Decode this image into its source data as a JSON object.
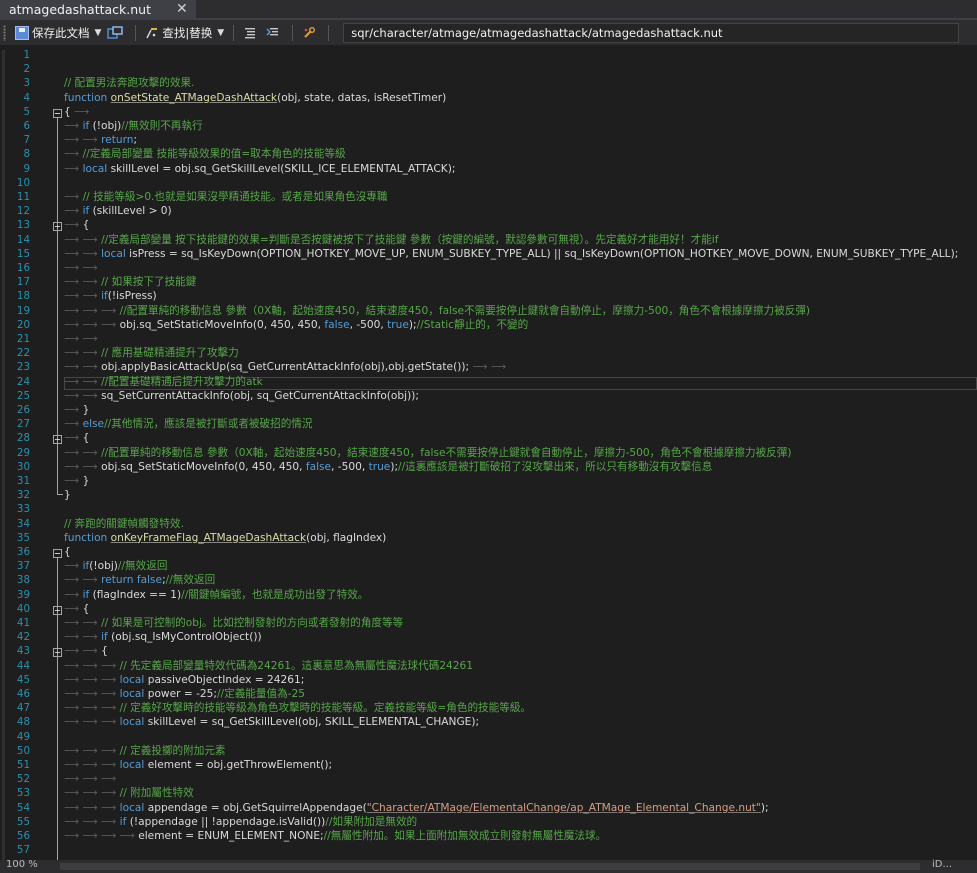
{
  "tab": {
    "title": "atmagedashattack.nut",
    "close_glyph": "✕"
  },
  "toolbar": {
    "save_label": "保存此文档",
    "find_replace_label": "查找|替换",
    "file_path": "sqr/character/atmage/atmagedashattack/atmagedashattack.nut"
  },
  "status": {
    "zoom": "100 %",
    "right_fragment": "iD..."
  },
  "colors": {
    "keyword": "#569cd6",
    "comment": "#57a64a",
    "string": "#d69d85",
    "line_number": "#2b91af",
    "text": "#dcdcdc"
  },
  "lines": [
    {
      "n": "1",
      "parts": []
    },
    {
      "n": "2",
      "parts": []
    },
    {
      "n": "3",
      "parts": [
        [
          "c",
          "// 配置男法奔跑攻擊的效果."
        ]
      ]
    },
    {
      "n": "4",
      "parts": [
        [
          "k",
          "function "
        ],
        [
          "f",
          "onSetState_ATMageDashAttack"
        ],
        [
          "",
          "(obj, state, datas, isResetTimer)"
        ]
      ]
    },
    {
      "n": "5",
      "parts": [
        [
          "",
          "{ "
        ],
        [
          "a",
          "⟶"
        ]
      ]
    },
    {
      "n": "6",
      "parts": [
        [
          "a",
          "⟶ "
        ],
        [
          "k",
          "if"
        ],
        [
          "",
          " (!obj)"
        ],
        [
          "c",
          "//無效則不再執行"
        ]
      ]
    },
    {
      "n": "7",
      "parts": [
        [
          "a",
          "⟶ ⟶ "
        ],
        [
          "k",
          "return"
        ],
        [
          "",
          ";"
        ]
      ]
    },
    {
      "n": "8",
      "parts": [
        [
          "a",
          "⟶ "
        ],
        [
          "c",
          "//定義局部變量 技能等級效果的值=取本角色的技能等級"
        ]
      ]
    },
    {
      "n": "9",
      "parts": [
        [
          "a",
          "⟶ "
        ],
        [
          "k",
          "local"
        ],
        [
          "",
          " skillLevel = obj.sq_GetSkillLevel(SKILL_ICE_ELEMENTAL_ATTACK);"
        ]
      ]
    },
    {
      "n": "10",
      "parts": []
    },
    {
      "n": "11",
      "parts": [
        [
          "a",
          "⟶ "
        ],
        [
          "c",
          "// 技能等級>0.也就是如果沒學精通技能。或者是如果角色沒專職"
        ]
      ]
    },
    {
      "n": "12",
      "parts": [
        [
          "a",
          "⟶ "
        ],
        [
          "k",
          "if"
        ],
        [
          "",
          " (skillLevel > 0)"
        ]
      ]
    },
    {
      "n": "13",
      "parts": [
        [
          "a",
          "⟶ "
        ],
        [
          "",
          "{"
        ]
      ]
    },
    {
      "n": "14",
      "parts": [
        [
          "a",
          "⟶ ⟶ "
        ],
        [
          "c",
          "//定義局部變量 按下技能鍵的效果=判斷是否按鍵被按下了技能鍵 參數（按鍵的編號，默認參數可無視）。先定義好才能用好！才能if"
        ]
      ]
    },
    {
      "n": "15",
      "parts": [
        [
          "a",
          "⟶ ⟶ "
        ],
        [
          "k",
          "local"
        ],
        [
          "",
          " isPress = sq_IsKeyDown(OPTION_HOTKEY_MOVE_UP, ENUM_SUBKEY_TYPE_ALL) || sq_IsKeyDown(OPTION_HOTKEY_MOVE_DOWN, ENUM_SUBKEY_TYPE_ALL);"
        ]
      ]
    },
    {
      "n": "16",
      "parts": [
        [
          "a",
          "⟶ ⟶"
        ]
      ]
    },
    {
      "n": "17",
      "parts": [
        [
          "a",
          "⟶ ⟶ "
        ],
        [
          "c",
          "// 如果按下了技能鍵"
        ]
      ]
    },
    {
      "n": "18",
      "parts": [
        [
          "a",
          "⟶ ⟶ "
        ],
        [
          "k",
          "if"
        ],
        [
          "",
          "(!isPress)"
        ]
      ]
    },
    {
      "n": "19",
      "parts": [
        [
          "a",
          "⟶ ⟶ ⟶ "
        ],
        [
          "c",
          "//配置單純的移動信息 參數（0X軸，起始速度450，結束速度450，false不需要按停止鍵就會自動停止，摩擦力-500，角色不會根據摩擦力被反彈)"
        ]
      ]
    },
    {
      "n": "20",
      "parts": [
        [
          "a",
          "⟶ ⟶ ⟶ "
        ],
        [
          "",
          "obj.sq_SetStaticMoveInfo(0, 450, 450, "
        ],
        [
          "k",
          "false"
        ],
        [
          "",
          ", -500, "
        ],
        [
          "k",
          "true"
        ],
        [
          "",
          ");"
        ],
        [
          "c",
          "//Static靜止的，不變的"
        ]
      ]
    },
    {
      "n": "21",
      "parts": [
        [
          "a",
          "⟶ ⟶"
        ]
      ]
    },
    {
      "n": "22",
      "parts": [
        [
          "a",
          "⟶ ⟶ "
        ],
        [
          "c",
          "// 應用基礎精通提升了攻擊力"
        ]
      ]
    },
    {
      "n": "23",
      "parts": [
        [
          "a",
          "⟶ ⟶ "
        ],
        [
          "",
          "obj.applyBasicAttackUp(sq_GetCurrentAttackInfo(obj),obj.getState()); "
        ],
        [
          "a",
          "⟶ ⟶"
        ]
      ]
    },
    {
      "n": "24",
      "parts": [
        [
          "a",
          "⟶ ⟶ "
        ],
        [
          "c",
          "//配置基礎精通后提升攻擊力的atk"
        ]
      ]
    },
    {
      "n": "25",
      "parts": [
        [
          "a",
          "⟶ ⟶ "
        ],
        [
          "",
          "sq_SetCurrentAttackInfo(obj, sq_GetCurrentAttackInfo(obj));"
        ]
      ]
    },
    {
      "n": "26",
      "parts": [
        [
          "a",
          "⟶ "
        ],
        [
          "",
          "}"
        ]
      ]
    },
    {
      "n": "27",
      "parts": [
        [
          "a",
          "⟶ "
        ],
        [
          "k",
          "else"
        ],
        [
          "c",
          "//其他情況，應該是被打斷或者被破招的情況"
        ]
      ]
    },
    {
      "n": "28",
      "parts": [
        [
          "a",
          "⟶ "
        ],
        [
          "",
          "{"
        ]
      ]
    },
    {
      "n": "29",
      "parts": [
        [
          "a",
          "⟶ ⟶ "
        ],
        [
          "c",
          "//配置單純的移動信息 參數（0X軸，起始速度450，結束速度450，false不需要按停止鍵就會自動停止，摩擦力-500，角色不會根據摩擦力被反彈)"
        ]
      ]
    },
    {
      "n": "30",
      "parts": [
        [
          "a",
          "⟶ ⟶ "
        ],
        [
          "",
          "obj.sq_SetStaticMoveInfo(0, 450, 450, "
        ],
        [
          "k",
          "false"
        ],
        [
          "",
          ", -500, "
        ],
        [
          "k",
          "true"
        ],
        [
          "",
          ");"
        ],
        [
          "c",
          "//這裏應該是被打斷破招了沒攻擊出來，所以只有移動沒有攻擊信息"
        ]
      ]
    },
    {
      "n": "31",
      "parts": [
        [
          "a",
          "⟶ "
        ],
        [
          "",
          "}"
        ]
      ]
    },
    {
      "n": "32",
      "parts": [
        [
          "",
          "}"
        ]
      ]
    },
    {
      "n": "33",
      "parts": []
    },
    {
      "n": "34",
      "parts": [
        [
          "c",
          "// 奔跑的關鍵幀觸發特效."
        ]
      ]
    },
    {
      "n": "35",
      "parts": [
        [
          "k",
          "function "
        ],
        [
          "f",
          "onKeyFrameFlag_ATMageDashAttack"
        ],
        [
          "",
          "(obj, flagIndex)"
        ]
      ]
    },
    {
      "n": "36",
      "parts": [
        [
          "",
          "{"
        ]
      ]
    },
    {
      "n": "37",
      "parts": [
        [
          "a",
          "⟶ "
        ],
        [
          "k",
          "if"
        ],
        [
          "",
          "(!obj)"
        ],
        [
          "c",
          "//無效返回"
        ]
      ]
    },
    {
      "n": "38",
      "parts": [
        [
          "a",
          "⟶ ⟶ "
        ],
        [
          "k",
          "return false"
        ],
        [
          "",
          ";"
        ],
        [
          "c",
          "//無效返回"
        ]
      ]
    },
    {
      "n": "39",
      "parts": [
        [
          "a",
          "⟶ "
        ],
        [
          "k",
          "if"
        ],
        [
          "",
          " (flagIndex == 1)"
        ],
        [
          "c",
          "//關鍵幀編號，也就是成功出發了特效。"
        ]
      ]
    },
    {
      "n": "40",
      "parts": [
        [
          "a",
          "⟶ "
        ],
        [
          "",
          "{"
        ]
      ]
    },
    {
      "n": "41",
      "parts": [
        [
          "a",
          "⟶ ⟶ "
        ],
        [
          "c",
          "// 如果是可控制的obj。比如控制發射的方向或者發射的角度等等"
        ]
      ]
    },
    {
      "n": "42",
      "parts": [
        [
          "a",
          "⟶ ⟶ "
        ],
        [
          "k",
          "if"
        ],
        [
          "",
          " (obj.sq_IsMyControlObject())"
        ]
      ]
    },
    {
      "n": "43",
      "parts": [
        [
          "a",
          "⟶ ⟶ "
        ],
        [
          "",
          "{"
        ]
      ]
    },
    {
      "n": "44",
      "parts": [
        [
          "a",
          "⟶ ⟶ ⟶ "
        ],
        [
          "c",
          "// 先定義局部變量特效代碼為24261。這裏意思為無屬性魔法球代碼24261"
        ]
      ]
    },
    {
      "n": "45",
      "parts": [
        [
          "a",
          "⟶ ⟶ ⟶ "
        ],
        [
          "k",
          "local"
        ],
        [
          "",
          " passiveObjectIndex = 24261;"
        ]
      ]
    },
    {
      "n": "46",
      "parts": [
        [
          "a",
          "⟶ ⟶ ⟶ "
        ],
        [
          "k",
          "local"
        ],
        [
          "",
          " power = -25;"
        ],
        [
          "c",
          "//定義能量值為-25"
        ]
      ]
    },
    {
      "n": "47",
      "parts": [
        [
          "a",
          "⟶ ⟶ ⟶ "
        ],
        [
          "c",
          "// 定義好攻擊時的技能等級為角色攻擊時的技能等級。定義技能等級=角色的技能等級。"
        ]
      ]
    },
    {
      "n": "48",
      "parts": [
        [
          "a",
          "⟶ ⟶ ⟶ "
        ],
        [
          "k",
          "local"
        ],
        [
          "",
          " skillLevel = sq_GetSkillLevel(obj, SKILL_ELEMENTAL_CHANGE);"
        ]
      ]
    },
    {
      "n": "49",
      "parts": []
    },
    {
      "n": "50",
      "parts": [
        [
          "a",
          "⟶ ⟶ ⟶ "
        ],
        [
          "c",
          "// 定義投擲的附加元素"
        ]
      ]
    },
    {
      "n": "51",
      "parts": [
        [
          "a",
          "⟶ ⟶ ⟶ "
        ],
        [
          "k",
          "local"
        ],
        [
          "",
          " element = obj.getThrowElement();"
        ]
      ]
    },
    {
      "n": "52",
      "parts": [
        [
          "a",
          "⟶ ⟶ ⟶"
        ]
      ]
    },
    {
      "n": "53",
      "parts": [
        [
          "a",
          "⟶ ⟶ ⟶ "
        ],
        [
          "c",
          "// 附加屬性特效"
        ]
      ]
    },
    {
      "n": "54",
      "parts": [
        [
          "a",
          "⟶ ⟶ ⟶ "
        ],
        [
          "k",
          "local"
        ],
        [
          "",
          " appendage = obj.GetSquirrelAppendage("
        ],
        [
          "s",
          "\"Character/ATMage/ElementalChange/ap_ATMage_Elemental_Change.nut\""
        ],
        [
          "",
          ");"
        ]
      ]
    },
    {
      "n": "55",
      "parts": [
        [
          "a",
          "⟶ ⟶ ⟶ "
        ],
        [
          "k",
          "if"
        ],
        [
          "",
          " (!appendage || !appendage.isValid())"
        ],
        [
          "c",
          "//如果附加是無效的"
        ]
      ]
    },
    {
      "n": "56",
      "parts": [
        [
          "a",
          "⟶ ⟶ ⟶ ⟶ "
        ],
        [
          "",
          "element = ENUM_ELEMENT_NONE;"
        ],
        [
          "c",
          "//無屬性附加。如果上面附加無效成立則發射無屬性魔法球。"
        ]
      ]
    },
    {
      "n": "57",
      "parts": []
    }
  ]
}
